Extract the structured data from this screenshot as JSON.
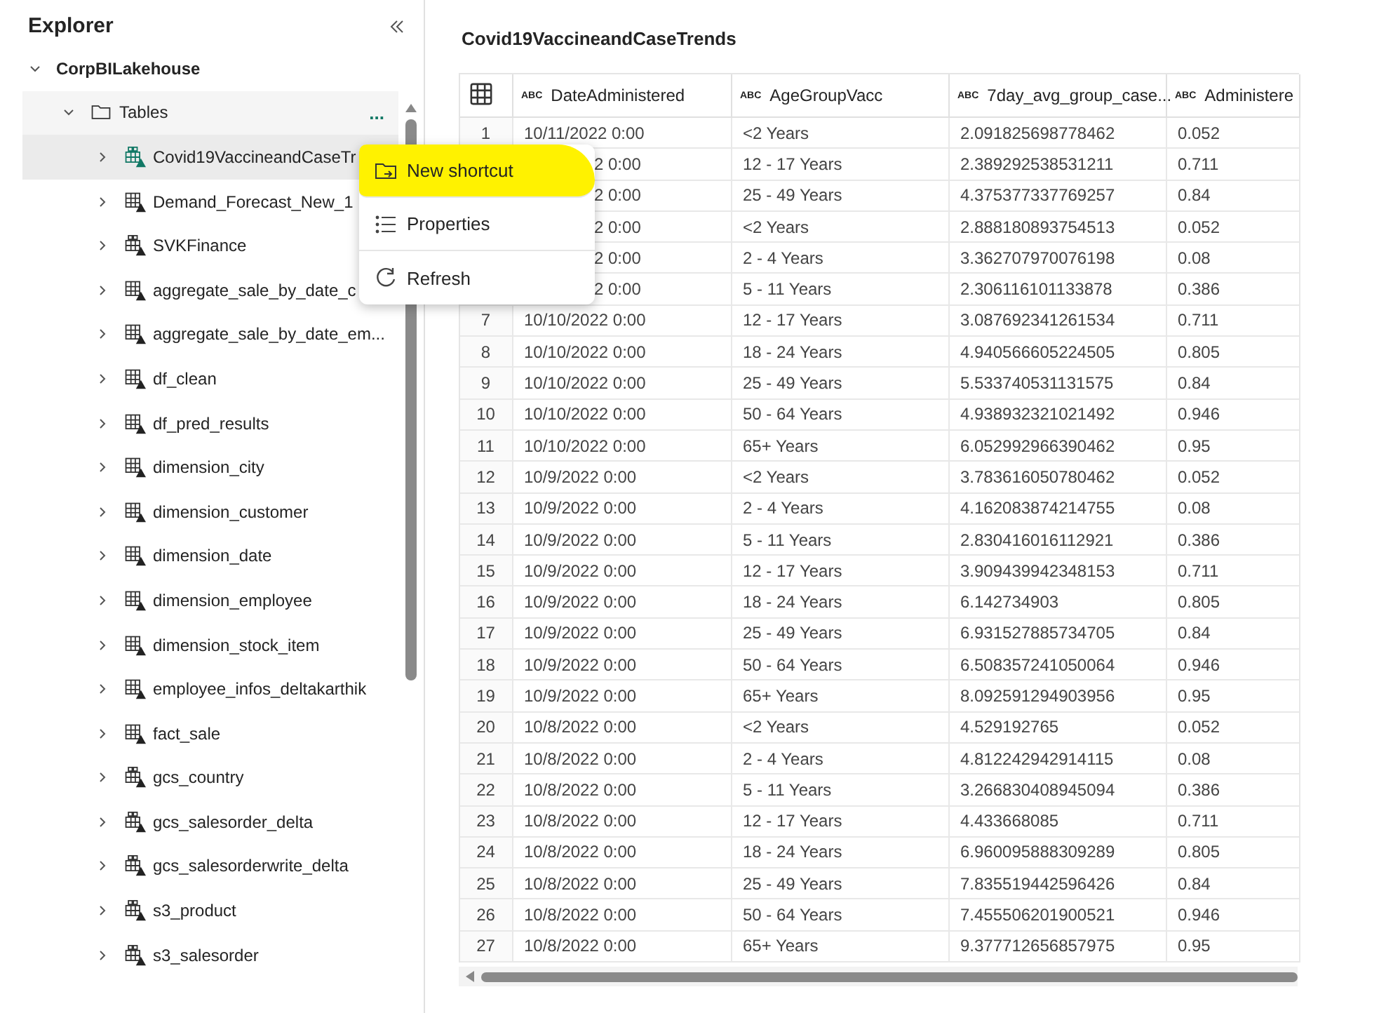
{
  "explorer": {
    "title": "Explorer",
    "root": {
      "label": "CorpBILakehouse",
      "expanded": true,
      "children": [
        {
          "label": "Tables",
          "expanded": true,
          "more": "...",
          "children": [
            {
              "label": "Covid19VaccineandCaseTr",
              "kind": "shortcut",
              "selected": true
            },
            {
              "label": "Demand_Forecast_New_1",
              "kind": "table",
              "selected": false
            },
            {
              "label": "SVKFinance",
              "kind": "shortcut",
              "selected": false
            },
            {
              "label": "aggregate_sale_by_date_c",
              "kind": "table",
              "selected": false
            },
            {
              "label": "aggregate_sale_by_date_em...",
              "kind": "table",
              "selected": false
            },
            {
              "label": "df_clean",
              "kind": "table",
              "selected": false
            },
            {
              "label": "df_pred_results",
              "kind": "table",
              "selected": false
            },
            {
              "label": "dimension_city",
              "kind": "table",
              "selected": false
            },
            {
              "label": "dimension_customer",
              "kind": "table",
              "selected": false
            },
            {
              "label": "dimension_date",
              "kind": "table",
              "selected": false
            },
            {
              "label": "dimension_employee",
              "kind": "table",
              "selected": false
            },
            {
              "label": "dimension_stock_item",
              "kind": "table",
              "selected": false
            },
            {
              "label": "employee_infos_deltakarthik",
              "kind": "table",
              "selected": false
            },
            {
              "label": "fact_sale",
              "kind": "table",
              "selected": false
            },
            {
              "label": "gcs_country",
              "kind": "shortcut",
              "selected": false
            },
            {
              "label": "gcs_salesorder_delta",
              "kind": "shortcut",
              "selected": false
            },
            {
              "label": "gcs_salesorderwrite_delta",
              "kind": "shortcut",
              "selected": false
            },
            {
              "label": "s3_product",
              "kind": "shortcut",
              "selected": false
            },
            {
              "label": "s3_salesorder",
              "kind": "shortcut",
              "selected": false
            }
          ]
        }
      ]
    }
  },
  "context_menu": {
    "items": [
      {
        "label": "New shortcut",
        "kind": "shortcut",
        "highlighted": true
      },
      {
        "label": "Properties",
        "kind": "properties",
        "highlighted": false
      },
      {
        "label": "Refresh",
        "kind": "refresh",
        "highlighted": false
      }
    ]
  },
  "table": {
    "title": "Covid19VaccineandCaseTrends",
    "columns": [
      {
        "type": "ABC",
        "label": "DateAdministered"
      },
      {
        "type": "ABC",
        "label": "AgeGroupVacc"
      },
      {
        "type": "ABC",
        "label": "7day_avg_group_case..."
      },
      {
        "type": "ABC",
        "label": "Administere"
      }
    ],
    "rows": [
      {
        "num": "1",
        "cells": [
          "10/11/2022 0:00",
          "<2 Years",
          "2.091825698778462",
          "0.052"
        ]
      },
      {
        "covered": true,
        "cells": [
          "2 0:00",
          "12 - 17 Years",
          "2.389292538531211",
          "0.711"
        ]
      },
      {
        "covered": true,
        "cells": [
          "2 0:00",
          "25 - 49 Years",
          "4.375377337769257",
          "0.84"
        ]
      },
      {
        "covered": true,
        "cells": [
          "2 0:00",
          "<2 Years",
          "2.888180893754513",
          "0.052"
        ]
      },
      {
        "covered": true,
        "cells": [
          "2 0:00",
          "2 - 4 Years",
          "3.362707970076198",
          "0.08"
        ]
      },
      {
        "covered": true,
        "cells": [
          "2 0:00",
          "5 - 11 Years",
          "2.306116101133878",
          "0.386"
        ]
      },
      {
        "num": "7",
        "cells": [
          "10/10/2022 0:00",
          "12 - 17 Years",
          "3.087692341261534",
          "0.711"
        ]
      },
      {
        "num": "8",
        "cells": [
          "10/10/2022 0:00",
          "18 - 24 Years",
          "4.940566605224505",
          "0.805"
        ]
      },
      {
        "num": "9",
        "cells": [
          "10/10/2022 0:00",
          "25 - 49 Years",
          "5.533740531131575",
          "0.84"
        ]
      },
      {
        "num": "10",
        "cells": [
          "10/10/2022 0:00",
          "50 - 64 Years",
          "4.938932321021492",
          "0.946"
        ]
      },
      {
        "num": "11",
        "cells": [
          "10/10/2022 0:00",
          "65+ Years",
          "6.052992966390462",
          "0.95"
        ]
      },
      {
        "num": "12",
        "cells": [
          "10/9/2022 0:00",
          "<2 Years",
          "3.783616050780462",
          "0.052"
        ]
      },
      {
        "num": "13",
        "cells": [
          "10/9/2022 0:00",
          "2 - 4 Years",
          "4.162083874214755",
          "0.08"
        ]
      },
      {
        "num": "14",
        "cells": [
          "10/9/2022 0:00",
          "5 - 11 Years",
          "2.830416016112921",
          "0.386"
        ]
      },
      {
        "num": "15",
        "cells": [
          "10/9/2022 0:00",
          "12 - 17 Years",
          "3.909439942348153",
          "0.711"
        ]
      },
      {
        "num": "16",
        "cells": [
          "10/9/2022 0:00",
          "18 - 24 Years",
          "6.142734903",
          "0.805"
        ]
      },
      {
        "num": "17",
        "cells": [
          "10/9/2022 0:00",
          "25 - 49 Years",
          "6.931527885734705",
          "0.84"
        ]
      },
      {
        "num": "18",
        "cells": [
          "10/9/2022 0:00",
          "50 - 64 Years",
          "6.508357241050064",
          "0.946"
        ]
      },
      {
        "num": "19",
        "cells": [
          "10/9/2022 0:00",
          "65+ Years",
          "8.092591294903956",
          "0.95"
        ]
      },
      {
        "num": "20",
        "cells": [
          "10/8/2022 0:00",
          "<2 Years",
          "4.529192765",
          "0.052"
        ]
      },
      {
        "num": "21",
        "cells": [
          "10/8/2022 0:00",
          "2 - 4 Years",
          "4.812242942914115",
          "0.08"
        ]
      },
      {
        "num": "22",
        "cells": [
          "10/8/2022 0:00",
          "5 - 11 Years",
          "3.266830408945094",
          "0.386"
        ]
      },
      {
        "num": "23",
        "cells": [
          "10/8/2022 0:00",
          "12 - 17 Years",
          "4.433668085",
          "0.711"
        ]
      },
      {
        "num": "24",
        "cells": [
          "10/8/2022 0:00",
          "18 - 24 Years",
          "6.960095888309289",
          "0.805"
        ]
      },
      {
        "num": "25",
        "cells": [
          "10/8/2022 0:00",
          "25 - 49 Years",
          "7.835519442596426",
          "0.84"
        ]
      },
      {
        "num": "26",
        "cells": [
          "10/8/2022 0:00",
          "50 - 64 Years",
          "7.455506201900521",
          "0.946"
        ]
      },
      {
        "num": "27",
        "cells": [
          "10/8/2022 0:00",
          "65+ Years",
          "9.377712656857975",
          "0.95"
        ]
      }
    ]
  }
}
